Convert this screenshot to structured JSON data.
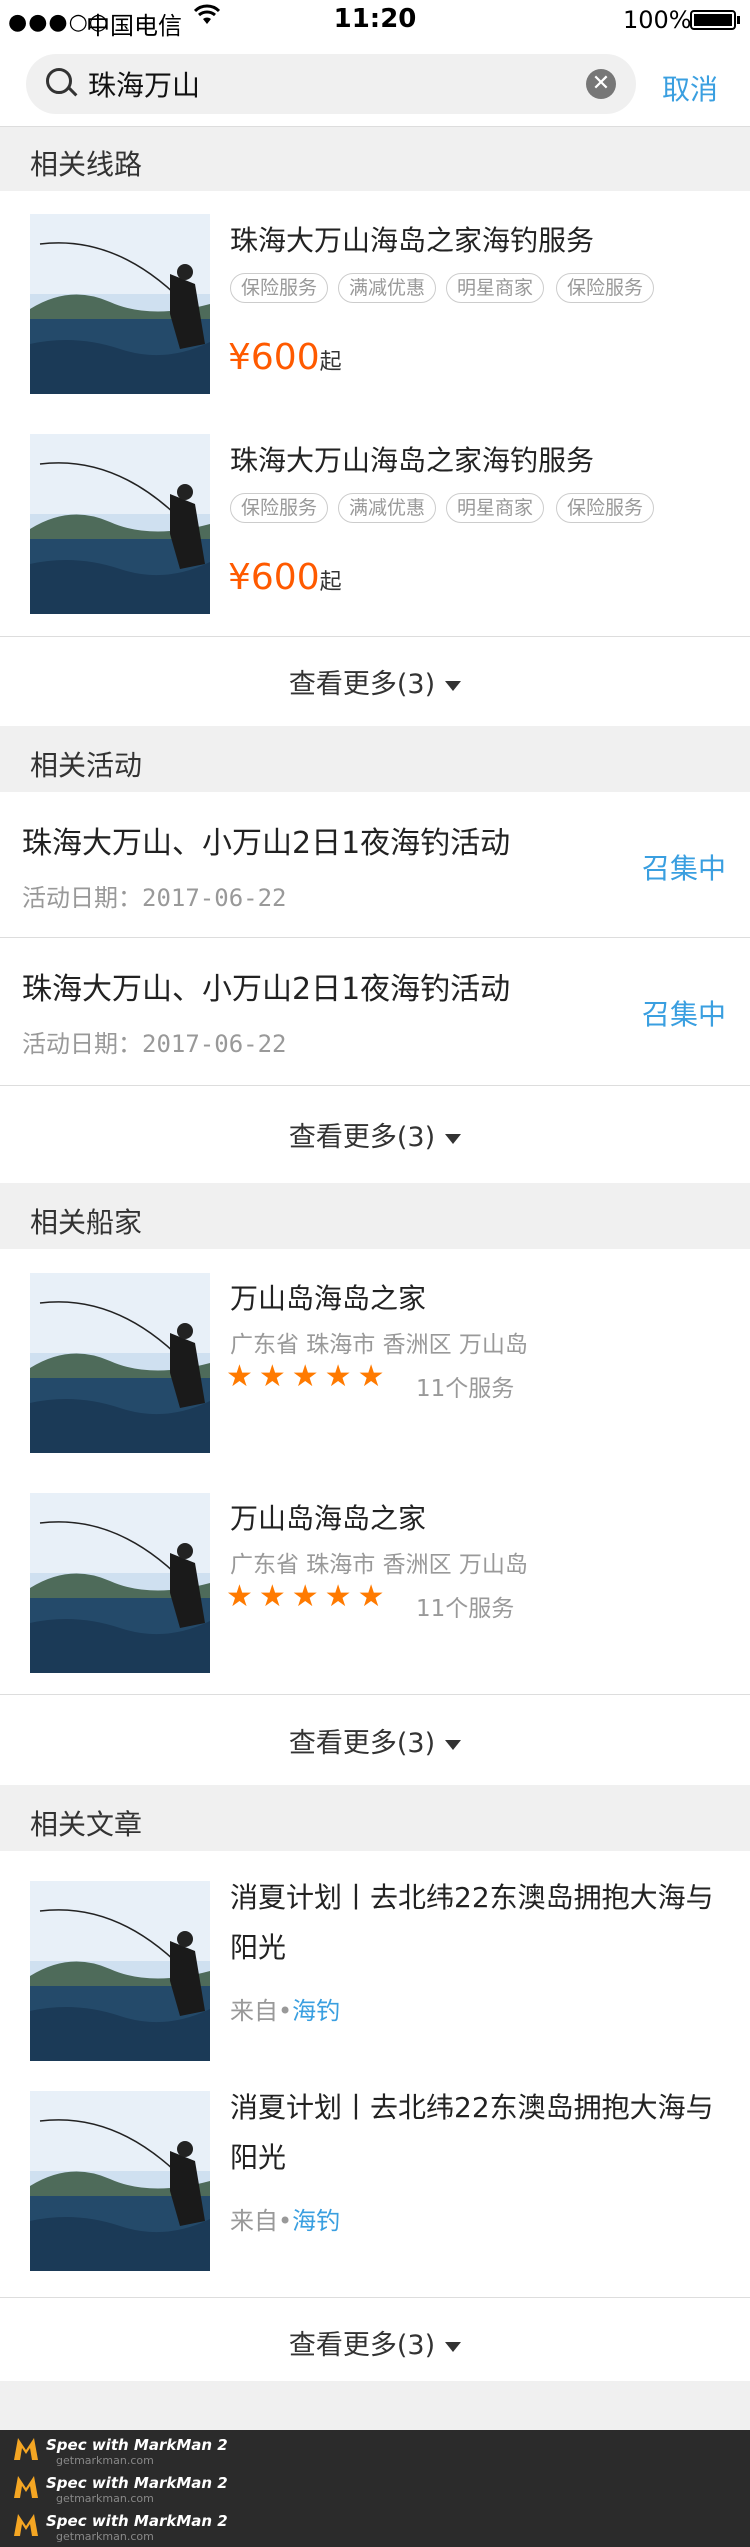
{
  "status_bar": {
    "signal": "●●●○○",
    "carrier": "中国电信",
    "time": "11:20",
    "battery": "100%"
  },
  "search": {
    "value": "珠海万山",
    "cancel": "取消"
  },
  "routes": {
    "header": "相关线路",
    "items": [
      {
        "title": "珠海大万山海岛之家海钓服务",
        "tags": [
          "保险服务",
          "满减优惠",
          "明星商家",
          "保险服务"
        ],
        "price": "¥600",
        "price_suffix": "起"
      },
      {
        "title": "珠海大万山海岛之家海钓服务",
        "tags": [
          "保险服务",
          "满减优惠",
          "明星商家",
          "保险服务"
        ],
        "price": "¥600",
        "price_suffix": "起"
      }
    ],
    "more": "查看更多(3)"
  },
  "activities": {
    "header": "相关活动",
    "items": [
      {
        "title": "珠海大万山、小万山2日1夜海钓活动",
        "date": "活动日期：2017-06-22",
        "status": "召集中"
      },
      {
        "title": "珠海大万山、小万山2日1夜海钓活动",
        "date": "活动日期：2017-06-22",
        "status": "召集中"
      }
    ],
    "more": "查看更多(3)"
  },
  "boats": {
    "header": "相关船家",
    "items": [
      {
        "name": "万山岛海岛之家",
        "location": "广东省  珠海市  香洲区  万山岛",
        "rating": 5,
        "services": "11个服务"
      },
      {
        "name": "万山岛海岛之家",
        "location": "广东省  珠海市  香洲区  万山岛",
        "rating": 5,
        "services": "11个服务"
      }
    ],
    "more": "查看更多(3)"
  },
  "articles": {
    "header": "相关文章",
    "items": [
      {
        "title": "消夏计划丨去北纬22东澳岛拥抱大海与阳光",
        "source_prefix": "来自•",
        "source": "海钓"
      },
      {
        "title": "消夏计划丨去北纬22东澳岛拥抱大海与阳光",
        "source_prefix": "来自•",
        "source": "海钓"
      }
    ],
    "more": "查看更多(3)"
  },
  "footer": {
    "brand": "Spec with MarkMan 2",
    "url": "getmarkman.com"
  },
  "colors": {
    "accent": "#3a9fe0",
    "price": "#ff5a00",
    "star": "#ff7a00",
    "section_bg": "#f0f0f0"
  }
}
